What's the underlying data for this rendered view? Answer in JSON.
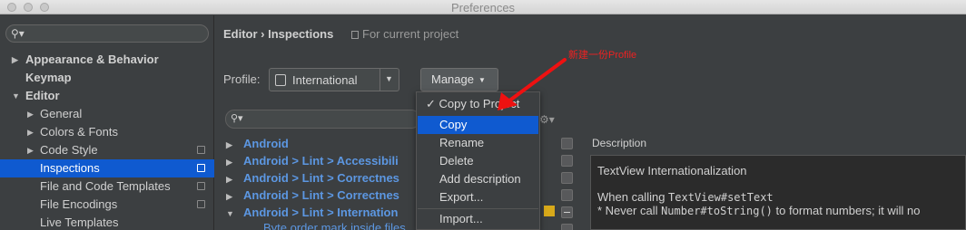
{
  "window": {
    "title": "Preferences"
  },
  "sidebar": {
    "items": [
      {
        "label": "Appearance & Behavior"
      },
      {
        "label": "Keymap"
      },
      {
        "label": "Editor"
      },
      {
        "label": "General"
      },
      {
        "label": "Colors & Fonts"
      },
      {
        "label": "Code Style"
      },
      {
        "label": "Inspections"
      },
      {
        "label": "File and Code Templates"
      },
      {
        "label": "File Encodings"
      },
      {
        "label": "Live Templates"
      }
    ]
  },
  "main": {
    "breadcrumb": "Editor › Inspections",
    "scope_note": "For current project",
    "profile_label": "Profile:",
    "profile_value": "International",
    "manage_label": "Manage",
    "tree": [
      {
        "label": "Android"
      },
      {
        "label": "Android > Lint > Accessibili"
      },
      {
        "label": "Android > Lint > Correctnes"
      },
      {
        "label": "Android > Lint > Correctnes"
      },
      {
        "label": "Android > Lint > Internation"
      }
    ],
    "tree_subrow": "Byte order mark inside files",
    "description_label": "Description",
    "description": {
      "title": "TextView Internationalization",
      "line2_prefix": "When calling ",
      "line2_code": "TextView#setText",
      "line3_prefix": "* Never call ",
      "line3_code": "Number#toString()",
      "line3_suffix": " to format numbers; it will no"
    }
  },
  "manage_menu": {
    "items": [
      {
        "label": "Copy to Project",
        "checked": true
      },
      {
        "label": "Copy"
      },
      {
        "label": "Rename"
      },
      {
        "label": "Delete"
      },
      {
        "label": "Add description"
      },
      {
        "label": "Export..."
      },
      {
        "label": "Import..."
      }
    ]
  },
  "annotation": {
    "text": "新建一份Profile",
    "color": "#ee2222"
  },
  "colors": {
    "accent": "#0f5ad0",
    "link": "#5c97e2",
    "warning": "#d8a91a"
  }
}
